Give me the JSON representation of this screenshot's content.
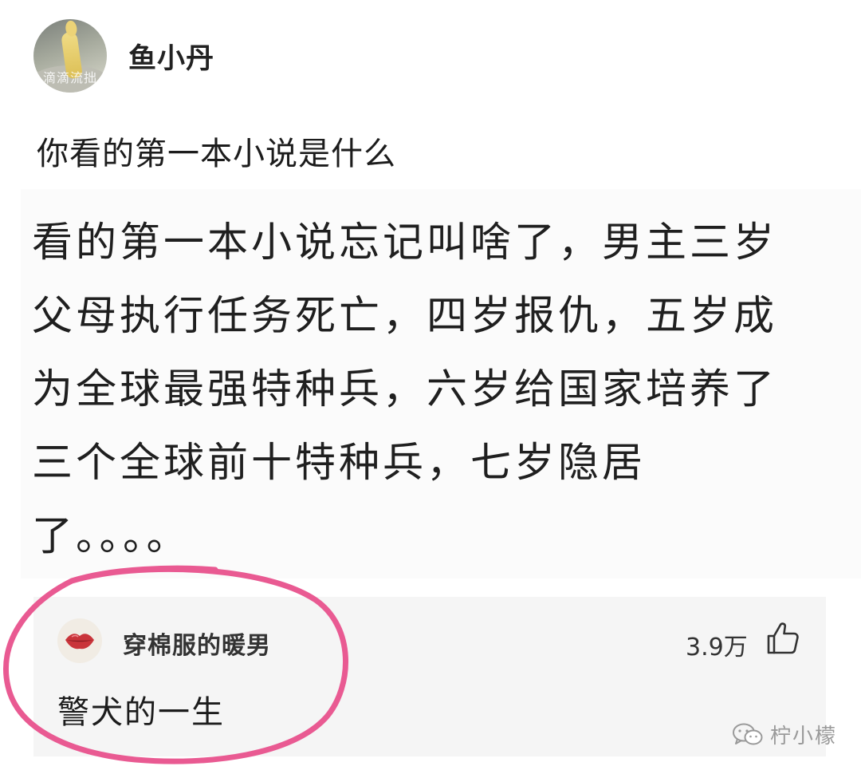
{
  "post": {
    "avatar_icon": "user-avatar-photo",
    "avatar_watermark": "滴滴流拙",
    "username": "鱼小丹",
    "question": "你看的第一本小说是什么"
  },
  "answer": {
    "text": "看的第一本小说忘记叫啥了，男主三岁\n父母执行任务死亡，四岁报仇，五岁成\n为全球最强特种兵，六岁给国家培养了\n三个全球前十特种兵，七岁隐居\n了。。。。"
  },
  "comment": {
    "avatar_icon": "lips-icon",
    "username": "穿棉服的暖男",
    "like_count": "3.9万",
    "like_icon": "thumbs-up-icon",
    "text": "警犬的一生"
  },
  "highlight": {
    "color": "#e95a92"
  },
  "watermark": {
    "icon": "wechat-icon",
    "text": "柠小檬"
  }
}
